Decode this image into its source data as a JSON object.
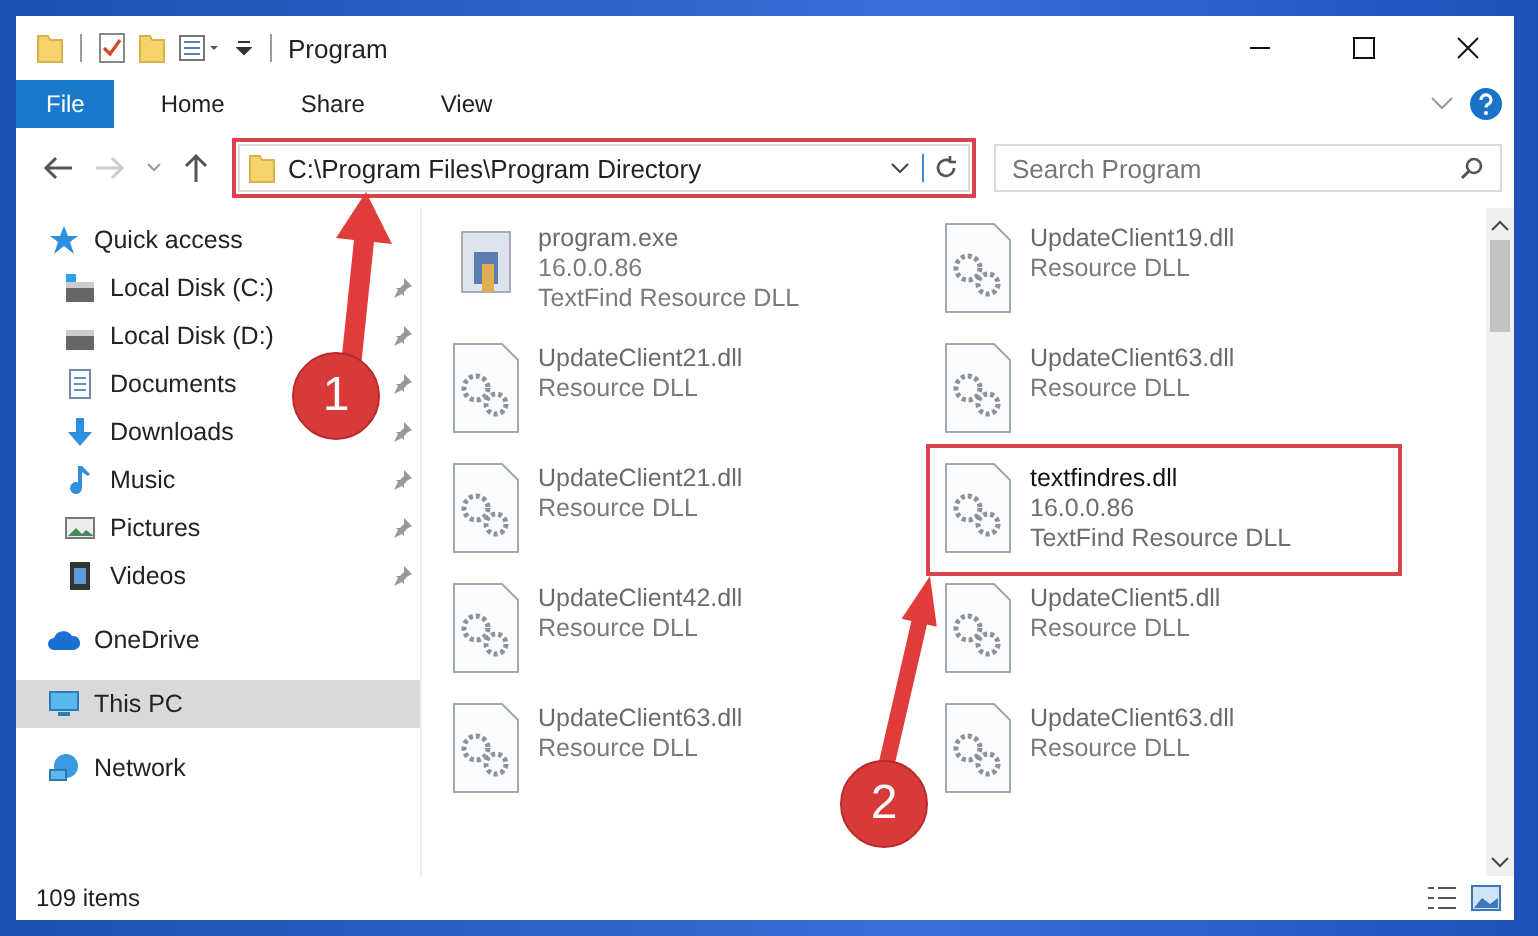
{
  "window": {
    "title": "Program"
  },
  "ribbon_tabs": [
    {
      "label": "File",
      "selected": true
    },
    {
      "label": "Home",
      "selected": false
    },
    {
      "label": "Share",
      "selected": false
    },
    {
      "label": "View",
      "selected": false
    }
  ],
  "address": {
    "path": "C:\\Program Files\\Program Directory",
    "annotation": "1"
  },
  "search": {
    "placeholder": "Search Program"
  },
  "sidebar": {
    "items": [
      {
        "label": "Quick access",
        "kind": "star",
        "selected": false,
        "children": [
          {
            "label": "Local Disk (C:)",
            "kind": "drive-c",
            "pinned": true,
            "selected": false
          },
          {
            "label": "Local Disk (D:)",
            "kind": "drive",
            "pinned": true,
            "selected": false
          },
          {
            "label": "Documents",
            "kind": "documents",
            "pinned": true,
            "selected": false
          },
          {
            "label": "Downloads",
            "kind": "downloads",
            "pinned": true,
            "selected": false
          },
          {
            "label": "Music",
            "kind": "music",
            "pinned": true,
            "selected": false
          },
          {
            "label": "Pictures",
            "kind": "pictures",
            "pinned": true,
            "selected": false
          },
          {
            "label": "Videos",
            "kind": "videos",
            "pinned": true,
            "selected": false
          }
        ]
      },
      {
        "label": "OneDrive",
        "kind": "cloud",
        "selected": false
      },
      {
        "label": "This PC",
        "kind": "pc",
        "selected": true
      },
      {
        "label": "Network",
        "kind": "network",
        "selected": false
      }
    ]
  },
  "files": [
    {
      "name": "program.exe",
      "details": [
        "16.0.0.86",
        "TextFind Resource DLL"
      ],
      "kind": "exe",
      "blurred": true
    },
    {
      "name": "UpdateClient19.dll",
      "details": [
        "Resource DLL"
      ],
      "kind": "dll",
      "blurred": true
    },
    {
      "name": "UpdateClient21.dll",
      "details": [
        "Resource DLL"
      ],
      "kind": "dll",
      "blurred": true
    },
    {
      "name": "UpdateClient63.dll",
      "details": [
        "Resource DLL"
      ],
      "kind": "dll",
      "blurred": true
    },
    {
      "name": "UpdateClient21.dll",
      "details": [
        "Resource DLL"
      ],
      "kind": "dll",
      "blurred": true
    },
    {
      "name": "textfindres.dll",
      "details": [
        "16.0.0.86",
        "TextFind Resource DLL"
      ],
      "kind": "dll",
      "blurred": false,
      "annotation": "2"
    },
    {
      "name": "UpdateClient42.dll",
      "details": [
        "Resource DLL"
      ],
      "kind": "dll",
      "blurred": true
    },
    {
      "name": "UpdateClient5.dll",
      "details": [
        "Resource DLL"
      ],
      "kind": "dll",
      "blurred": true
    },
    {
      "name": "UpdateClient63.dll",
      "details": [
        "Resource DLL"
      ],
      "kind": "dll",
      "blurred": true
    },
    {
      "name": "UpdateClient63.dll",
      "details": [
        "Resource DLL"
      ],
      "kind": "dll",
      "blurred": true
    }
  ],
  "status_bar": {
    "count": "109 items"
  }
}
